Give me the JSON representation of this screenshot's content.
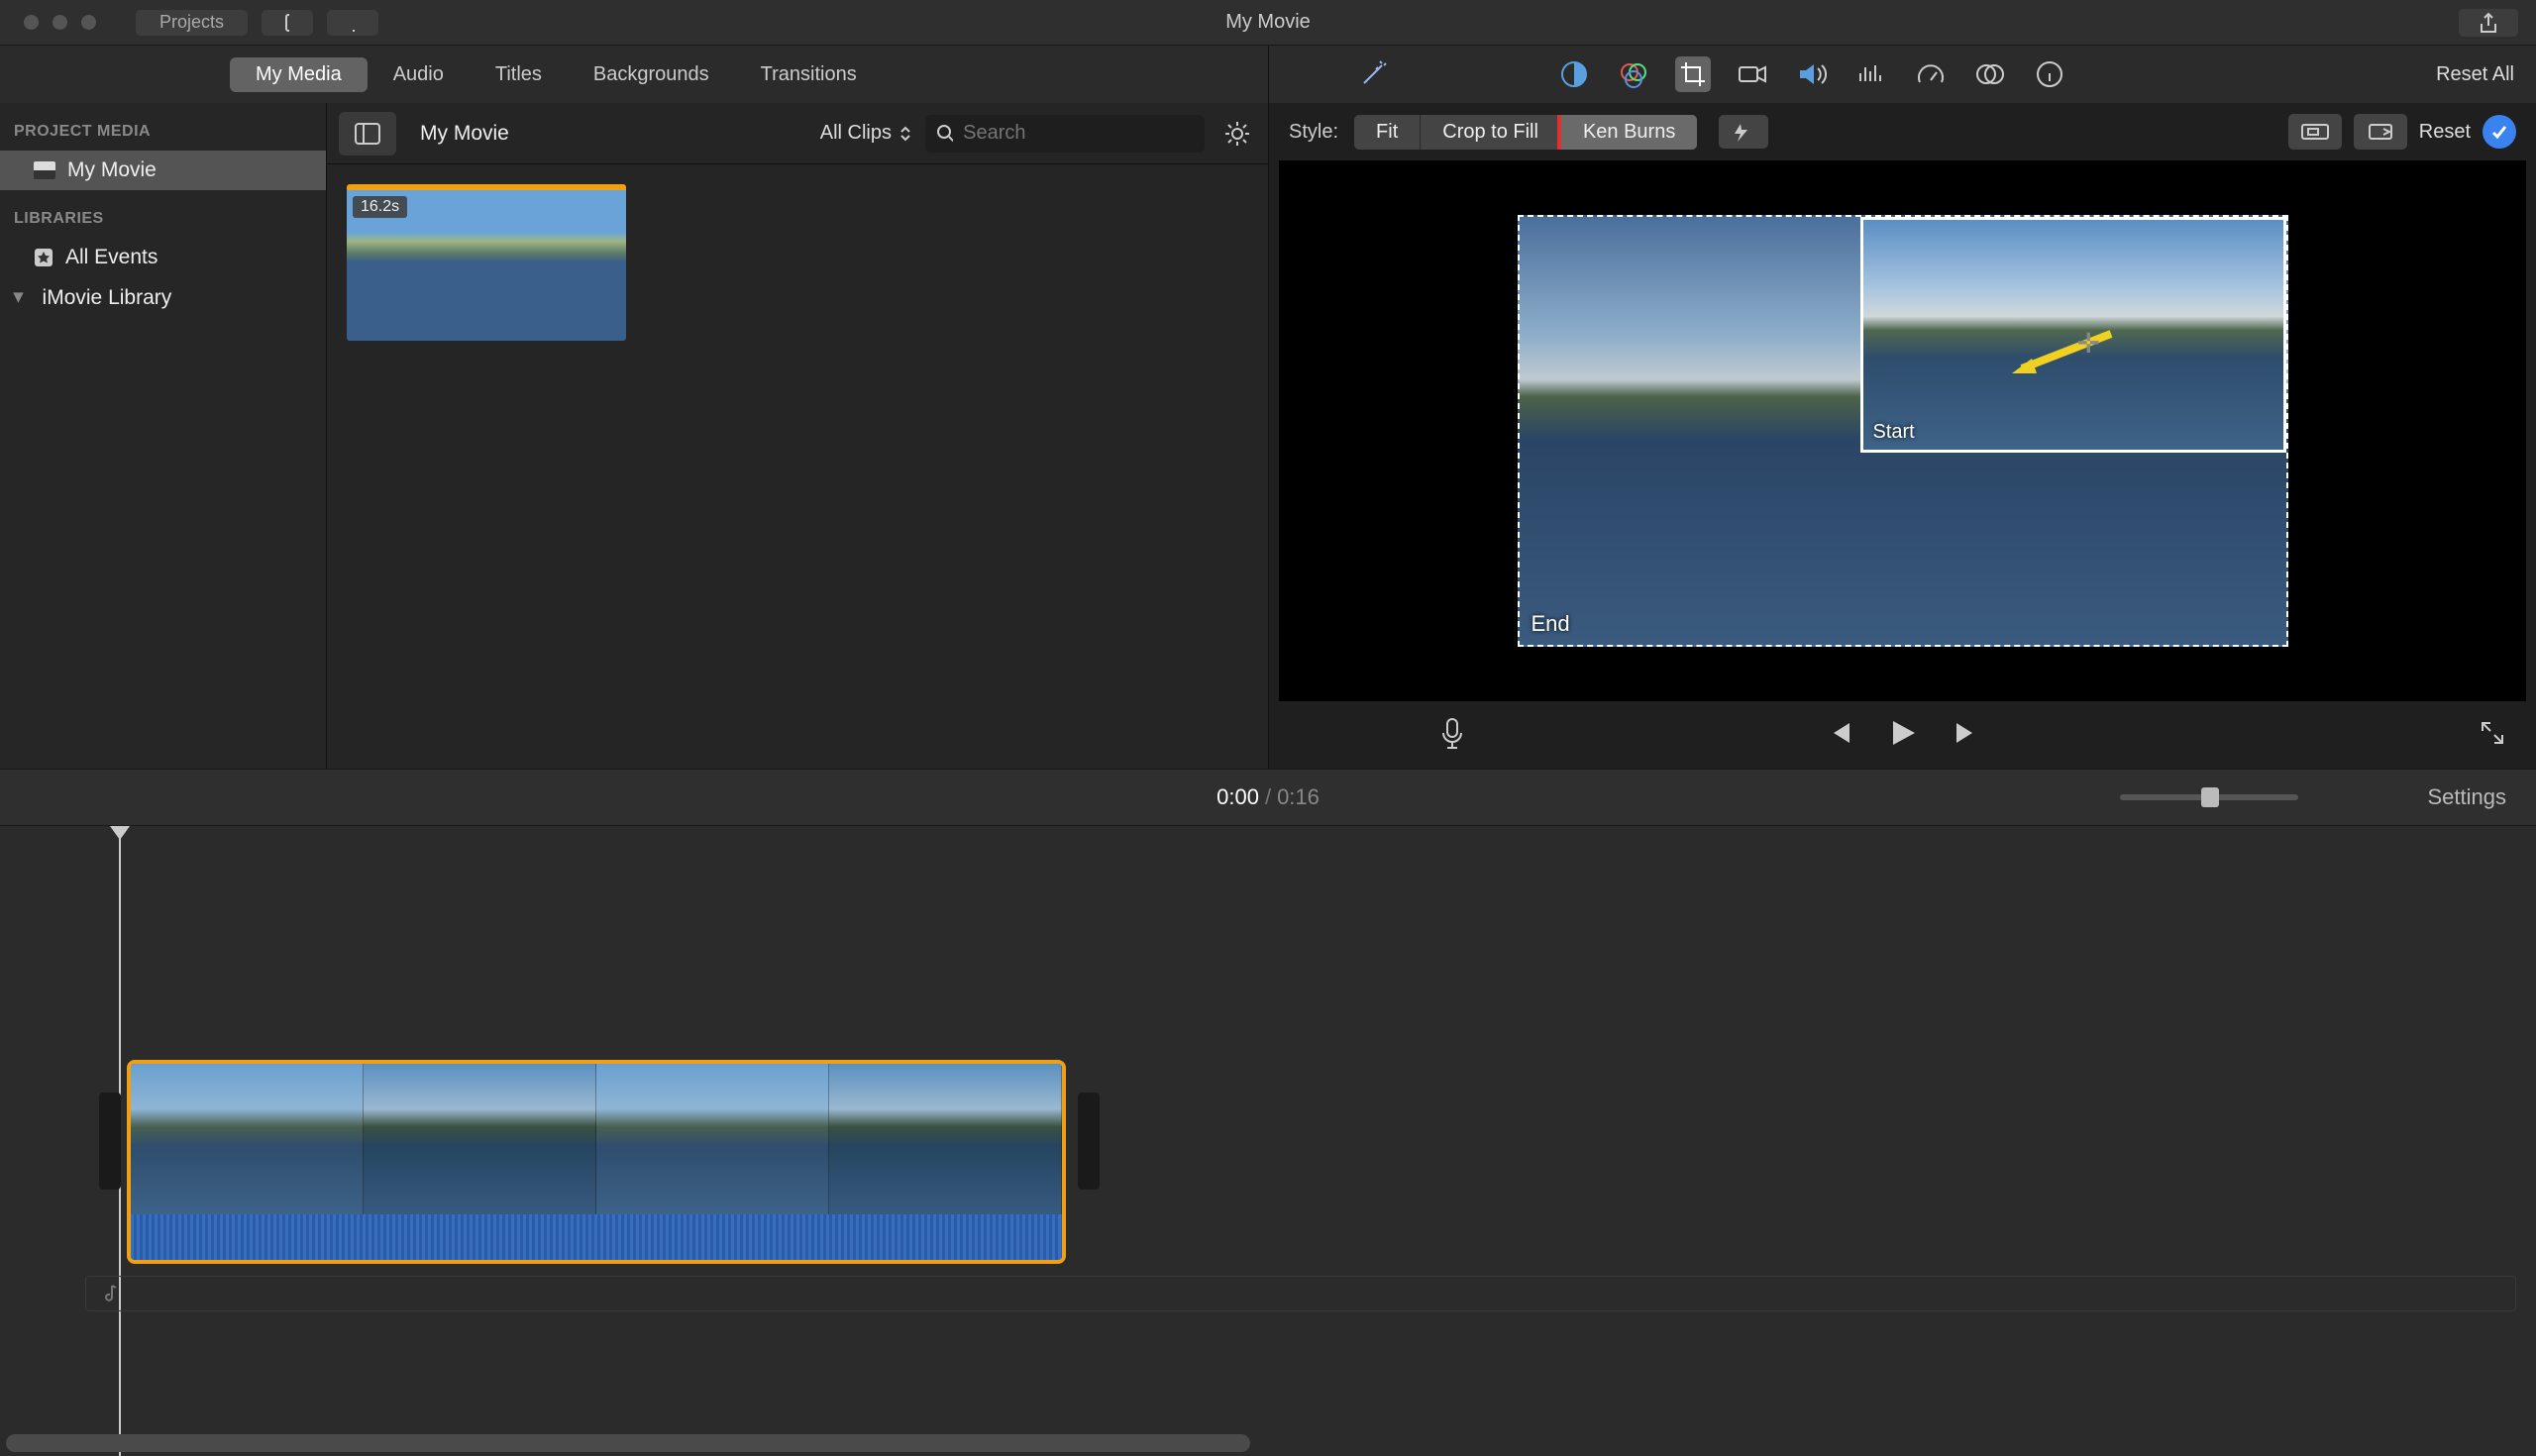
{
  "window": {
    "title": "My Movie",
    "projects_btn": "Projects"
  },
  "media_tabs": [
    "My Media",
    "Audio",
    "Titles",
    "Backgrounds",
    "Transitions"
  ],
  "media_tab_active": 0,
  "sidebar": {
    "project_media_hdr": "PROJECT MEDIA",
    "project_item": "My Movie",
    "libraries_hdr": "LIBRARIES",
    "all_events": "All Events",
    "imovie_library": "iMovie Library"
  },
  "browser": {
    "breadcrumb": "My Movie",
    "clips_filter": "All Clips",
    "search_placeholder": "Search",
    "clip_duration_badge": "16.2s"
  },
  "inspector": {
    "reset_all": "Reset All",
    "style_label": "Style:",
    "styles": [
      "Fit",
      "Crop to Fill",
      "Ken Burns"
    ],
    "style_selected": 2,
    "reset": "Reset"
  },
  "kenburns": {
    "start_label": "Start",
    "end_label": "End"
  },
  "transport": {
    "current": "0:00",
    "duration": "0:16",
    "settings": "Settings"
  },
  "colors": {
    "accent_orange": "#f0a015",
    "highlight_red": "#e03030",
    "blue": "#3a82f0"
  }
}
